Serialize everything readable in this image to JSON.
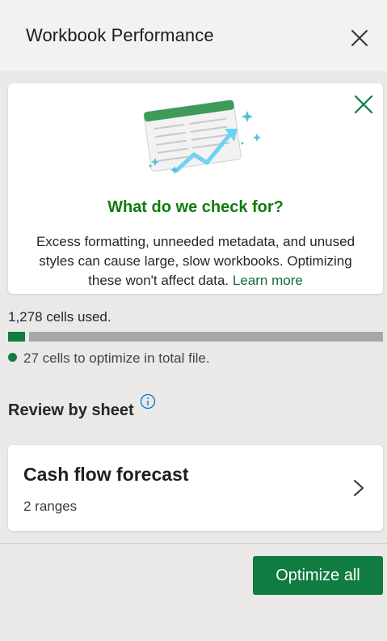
{
  "panel": {
    "title": "Workbook Performance"
  },
  "info_card": {
    "heading": "What do we check for?",
    "text": "Excess formatting, unneeded metadata, and unused styles can cause large, slow workbooks. Optimizing these won't affect data.",
    "link_text": "Learn more"
  },
  "usage": {
    "cells_used": "1,278 cells used.",
    "optimize_note": "27 cells to optimize in total file.",
    "used_fraction": 0.045
  },
  "review": {
    "label": "Review by sheet",
    "sheets": [
      {
        "name": "Cash flow forecast",
        "ranges": "2 ranges"
      }
    ]
  },
  "footer": {
    "optimize_all_label": "Optimize all"
  },
  "colors": {
    "accent_green": "#107c41",
    "heading_green": "#107c10",
    "bar_track": "#a6a6a6",
    "info_blue": "#0078d4"
  },
  "icons": {
    "close": "close-icon",
    "dismiss": "dismiss-icon",
    "info": "info-icon",
    "chevron": "chevron-right-icon"
  }
}
